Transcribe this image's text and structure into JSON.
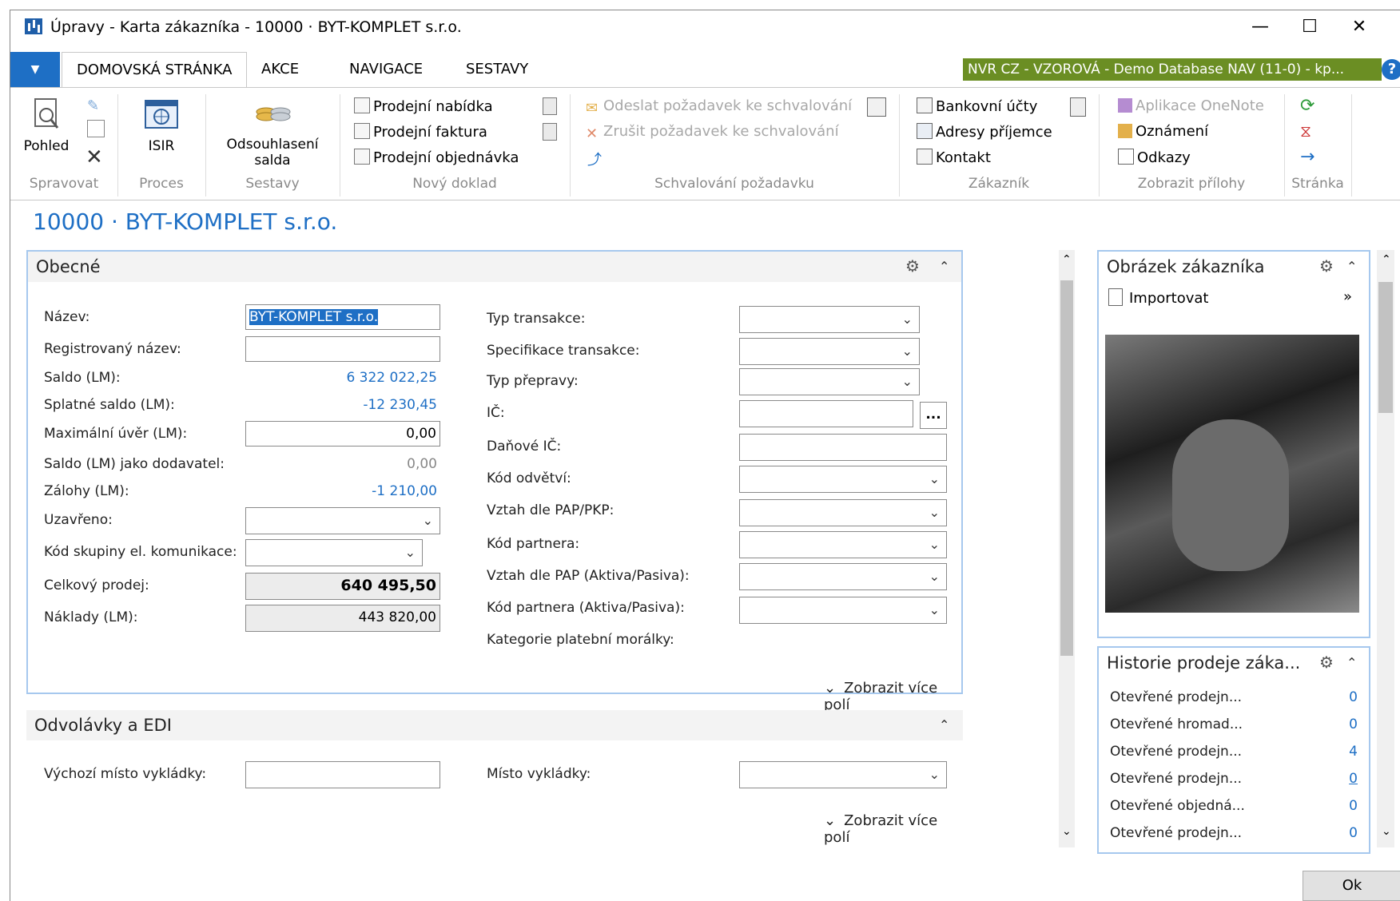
{
  "slide_heading": "",
  "window": {
    "title": "Úpravy - Karta zákazníka - 10000 · BYT-KOMPLET s.r.o.",
    "minimize": "—",
    "maximize": "☐",
    "close": "✕"
  },
  "ribbon_tabs": [
    "DOMOVSKÁ STRÁNKA",
    "AKCE",
    "NAVIGACE",
    "SESTAVY"
  ],
  "file_button": "▼",
  "database_badge": "NVR CZ - VZOROVÁ - Demo Database NAV (11-0) - kp...",
  "help": "?",
  "ribbon": {
    "spravovat": {
      "label": "Spravovat",
      "view": "Pohled"
    },
    "proces": {
      "label": "Proces",
      "isir": "ISIR"
    },
    "sestavy": {
      "label": "Sestavy",
      "odsouhlaseni": "Odsouhlasení salda"
    },
    "novy_doklad": {
      "label": "Nový doklad",
      "items": [
        "Prodejní nabídka",
        "Prodejní faktura",
        "Prodejní objednávka"
      ]
    },
    "schvalovani": {
      "label": "Schvalování požadavku",
      "items": [
        "Odeslat požadavek ke schvalování",
        "Zrušit požadavek ke schvalování"
      ]
    },
    "zakaznik": {
      "label": "Zákazník",
      "items": [
        "Bankovní účty",
        "Adresy příjemce",
        "Kontakt"
      ]
    },
    "prilohy": {
      "label": "Zobrazit přílohy",
      "items": [
        "Aplikace OneNote",
        "Oznámení",
        "Odkazy"
      ]
    },
    "stranka": {
      "label": "Stránka"
    }
  },
  "page_title": "10000 · BYT-KOMPLET s.r.o.",
  "general": {
    "header": "Obecné",
    "left": [
      {
        "label": "Název:",
        "value": "BYT-KOMPLET s.r.o."
      },
      {
        "label": "Registrovaný název:",
        "value": ""
      },
      {
        "label": "Saldo (LM):",
        "value": "6 322 022,25"
      },
      {
        "label": "Splatné saldo (LM):",
        "value": "-12 230,45"
      },
      {
        "label": "Maximální úvěr (LM):",
        "value": "0,00"
      },
      {
        "label": "Saldo (LM) jako dodavatel:",
        "value": "0,00"
      },
      {
        "label": "Zálohy (LM):",
        "value": "-1 210,00"
      },
      {
        "label": "Uzavřeno:",
        "value": ""
      },
      {
        "label": "Kód skupiny el. komunikace:",
        "value": ""
      },
      {
        "label": "Celkový prodej:",
        "value": "640 495,50"
      },
      {
        "label": "Náklady (LM):",
        "value": "443 820,00"
      }
    ],
    "right": [
      "Typ transakce:",
      "Specifikace transakce:",
      "Typ přepravy:",
      "IČ:",
      "Daňové IČ:",
      "Kód odvětví:",
      "Vztah dle PAP/PKP:",
      "Kód partnera:",
      "Vztah dle PAP (Aktiva/Pasiva):",
      "Kód partnera (Aktiva/Pasiva):",
      "Kategorie platební morálky:"
    ],
    "lookup": "...",
    "show_more": "Zobrazit více polí"
  },
  "edi": {
    "header": "Odvolávky a EDI",
    "left_label": "Výchozí místo vykládky:",
    "right_label": "Místo vykládky:",
    "show_more": "Zobrazit více polí"
  },
  "picture": {
    "header": "Obrázek zákazníka",
    "import": "Importovat",
    "more": "»"
  },
  "history": {
    "header": "Historie prodeje záka...",
    "rows": [
      {
        "label": "Otevřené prodejn...",
        "value": "0"
      },
      {
        "label": "Otevřené hromad...",
        "value": "0"
      },
      {
        "label": "Otevřené prodejn...",
        "value": "4"
      },
      {
        "label": "Otevřené prodejn...",
        "value": "0"
      },
      {
        "label": "Otevřené objedná...",
        "value": "0"
      },
      {
        "label": "Otevřené prodejn...",
        "value": "0"
      }
    ]
  },
  "ok_button": "Ok",
  "colors": {
    "accent": "#1e6fc5",
    "badge": "#6b8e23",
    "panel_border": "#a6c8ee"
  }
}
